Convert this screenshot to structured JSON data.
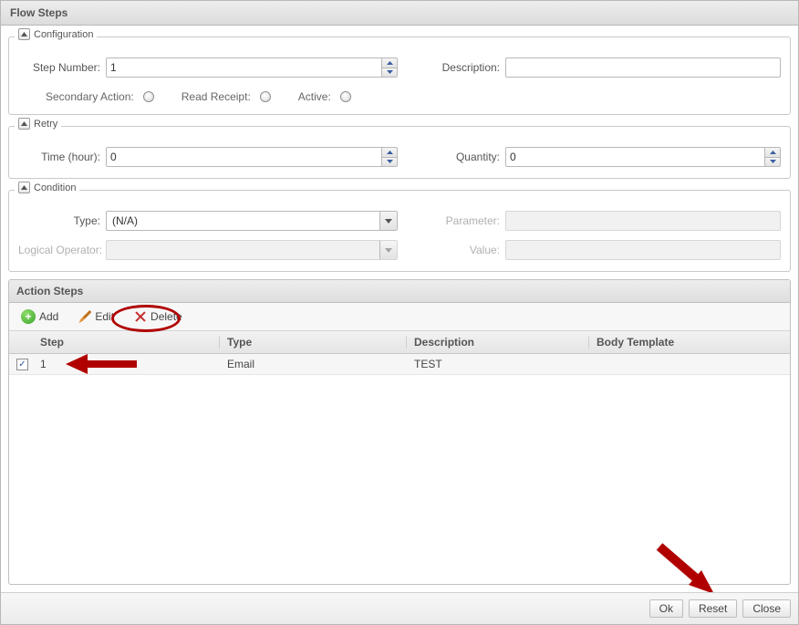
{
  "dialog_title": "Flow Steps",
  "configuration": {
    "legend": "Configuration",
    "step_number_label": "Step Number:",
    "step_number_value": "1",
    "description_label": "Description:",
    "description_value": "",
    "secondary_action_label": "Secondary Action:",
    "read_receipt_label": "Read Receipt:",
    "active_label": "Active:"
  },
  "retry": {
    "legend": "Retry",
    "time_label": "Time (hour):",
    "time_value": "0",
    "quantity_label": "Quantity:",
    "quantity_value": "0"
  },
  "condition": {
    "legend": "Condition",
    "type_label": "Type:",
    "type_value": "(N/A)",
    "parameter_label": "Parameter:",
    "parameter_value": "",
    "logical_operator_label": "Logical Operator:",
    "logical_operator_value": "",
    "value_label": "Value:",
    "value_value": ""
  },
  "action_steps": {
    "title": "Action Steps",
    "add_label": "Add",
    "edit_label": "Edit",
    "delete_label": "Delete",
    "columns": {
      "step": "Step",
      "type": "Type",
      "description": "Description",
      "body_template": "Body Template"
    },
    "rows": [
      {
        "checked": true,
        "step": "1",
        "type": "Email",
        "description": "TEST",
        "body_template": ""
      }
    ]
  },
  "footer": {
    "ok": "Ok",
    "reset": "Reset",
    "close": "Close"
  }
}
